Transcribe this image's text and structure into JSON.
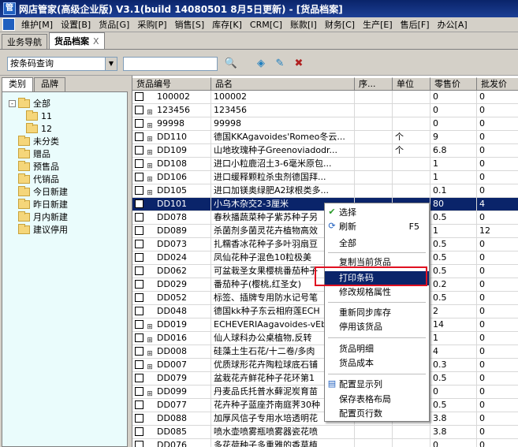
{
  "title": "网店管家(高级企业版) V3.1(build 14080501 8月5日更新) - [货品档案]",
  "menu": [
    "维护[M]",
    "设置[B]",
    "货品[G]",
    "采购[P]",
    "销售[S]",
    "库存[K]",
    "CRM[C]",
    "账款[I]",
    "财务[C]",
    "生产[E]",
    "售后[F]",
    "办公[A]"
  ],
  "doc_tabs": [
    {
      "label": "业务导航"
    },
    {
      "label": "货品档案",
      "close": "X"
    }
  ],
  "toolbar": {
    "query_mode": "按条码查询",
    "search_value": ""
  },
  "left_tabs": [
    "类别",
    "品牌"
  ],
  "tree": [
    {
      "label": "全部",
      "expander": "-"
    },
    {
      "label": "11"
    },
    {
      "label": "12"
    },
    {
      "label": "未分类"
    },
    {
      "label": "赠品"
    },
    {
      "label": "预售品"
    },
    {
      "label": "代销品"
    },
    {
      "label": "今日新建"
    },
    {
      "label": "昨日新建"
    },
    {
      "label": "月内新建"
    },
    {
      "label": "建议停用"
    }
  ],
  "grid": {
    "columns": [
      "货品编号",
      "品名",
      "序...",
      "单位",
      "零售价",
      "批发价"
    ],
    "rows": [
      {
        "code": "100002",
        "name": "100002",
        "seq": "",
        "unit": "",
        "retail": "0",
        "wholesale": "0",
        "icon": false
      },
      {
        "code": "123456",
        "name": "123456",
        "seq": "",
        "unit": "",
        "retail": "0",
        "wholesale": "0",
        "icon": true
      },
      {
        "code": "99998",
        "name": "99998",
        "seq": "",
        "unit": "",
        "retail": "0",
        "wholesale": "0",
        "icon": true
      },
      {
        "code": "DD110",
        "name": "德国KKAgavoides'Romeo冬云...",
        "seq": "",
        "unit": "个",
        "retail": "9",
        "wholesale": "0",
        "icon": true
      },
      {
        "code": "DD109",
        "name": "山地玫瑰种子Greenoviadodr...",
        "seq": "",
        "unit": "个",
        "retail": "6.8",
        "wholesale": "0",
        "icon": true
      },
      {
        "code": "DD108",
        "name": "进口小粒鹿沼土3-6毫米原包...",
        "seq": "",
        "unit": "",
        "retail": "1",
        "wholesale": "0",
        "icon": true
      },
      {
        "code": "DD106",
        "name": "进口缓释颗粒杀虫剂德国拜...",
        "seq": "",
        "unit": "",
        "retail": "1",
        "wholesale": "0",
        "icon": true
      },
      {
        "code": "DD105",
        "name": "进口加镁奥绿肥A2球根类多...",
        "seq": "",
        "unit": "",
        "retail": "0.1",
        "wholesale": "0",
        "icon": true
      },
      {
        "code": "DD101",
        "name": "小乌木杂交2-3厘米",
        "seq": "",
        "unit": "",
        "retail": "80",
        "wholesale": "4",
        "icon": false,
        "selected": true
      },
      {
        "code": "DD078",
        "name": "春秋播蔬菜种子紫苏种子另",
        "seq": "",
        "unit": "",
        "retail": "0.5",
        "wholesale": "0",
        "icon": false
      },
      {
        "code": "DD089",
        "name": "杀菌剂多菌灵花卉植物高效",
        "seq": "",
        "unit": "",
        "retail": "1",
        "wholesale": "12",
        "icon": false
      },
      {
        "code": "DD073",
        "name": "扎糯香冰花种子多叶羽扇豆",
        "seq": "",
        "unit": "",
        "retail": "0.5",
        "wholesale": "0",
        "icon": false
      },
      {
        "code": "DD024",
        "name": "凤仙花种子混色10粒极美",
        "seq": "",
        "unit": "",
        "retail": "0.5",
        "wholesale": "0",
        "icon": false
      },
      {
        "code": "DD062",
        "name": "可盆栽圣女果樱桃番茄种子",
        "seq": "",
        "unit": "",
        "retail": "0.5",
        "wholesale": "0",
        "icon": false
      },
      {
        "code": "DD029",
        "name": "番茄种子(樱桃,红圣女)",
        "seq": "",
        "unit": "",
        "retail": "0.2",
        "wholesale": "0",
        "icon": false
      },
      {
        "code": "DD052",
        "name": "标签、插牌专用防水记号笔",
        "seq": "",
        "unit": "",
        "retail": "0.5",
        "wholesale": "0",
        "icon": false
      },
      {
        "code": "DD048",
        "name": "德国kk种子东云相府莲ECH",
        "seq": "",
        "unit": "",
        "retail": "2",
        "wholesale": "0",
        "icon": false
      },
      {
        "code": "DD019",
        "name": "ECHEVERIAagavoides-vEbc",
        "seq": "",
        "unit": "",
        "retail": "14",
        "wholesale": "0",
        "icon": true
      },
      {
        "code": "DD016",
        "name": "仙人球科办公桌植物,反转",
        "seq": "",
        "unit": "",
        "retail": "1",
        "wholesale": "0",
        "icon": true
      },
      {
        "code": "DD008",
        "name": "硅藻土生石花/十二卷/多肉",
        "seq": "",
        "unit": "",
        "retail": "4",
        "wholesale": "0",
        "icon": true
      },
      {
        "code": "DD007",
        "name": "优质球形花卉陶粒球底石铺",
        "seq": "",
        "unit": "",
        "retail": "0.3",
        "wholesale": "0",
        "icon": true
      },
      {
        "code": "DD079",
        "name": "盆栽花卉鲜花种子花环第1",
        "seq": "",
        "unit": "",
        "retail": "0.5",
        "wholesale": "0",
        "icon": false
      },
      {
        "code": "DD099",
        "name": "丹麦品氏托普水藓泥炭育苗",
        "seq": "",
        "unit": "",
        "retail": "0",
        "wholesale": "0",
        "icon": true
      },
      {
        "code": "DD077",
        "name": "花卉种子蓝座芥南庭荠30种",
        "seq": "",
        "unit": "",
        "retail": "0.5",
        "wholesale": "0",
        "icon": false
      },
      {
        "code": "DD088",
        "name": "加厚风信子专用水培透明花",
        "seq": "",
        "unit": "",
        "retail": "3.8",
        "wholesale": "0",
        "icon": false
      },
      {
        "code": "DD085",
        "name": "喷水壶喷雾瓶喷雾器瓷花喷",
        "seq": "",
        "unit": "",
        "retail": "3.8",
        "wholesale": "0",
        "icon": false
      },
      {
        "code": "DD076",
        "name": "多花荷种子多重雅的香草植",
        "seq": "",
        "unit": "",
        "retail": "0",
        "wholesale": "0",
        "icon": false
      }
    ]
  },
  "context_menu": {
    "items": [
      {
        "label": "选择",
        "icon": "check-icon"
      },
      {
        "label": "刷新",
        "shortcut": "F5",
        "icon": "refresh-icon"
      },
      {
        "label": "全部"
      },
      {
        "label": "复制当前货品"
      },
      {
        "label": "打印条码",
        "highlighted": true
      },
      {
        "label": "修改规格属性"
      },
      {
        "label": "重新同步库存"
      },
      {
        "label": "停用该货品"
      },
      {
        "label": "货品明细"
      },
      {
        "label": "货品成本"
      },
      {
        "label": "配置显示列",
        "icon": "columns-icon"
      },
      {
        "label": "保存表格布局"
      },
      {
        "label": "配置页行数"
      }
    ]
  },
  "colors": {
    "selection": "#0a246a",
    "tree_bg": "#eafcfc",
    "highlight_border": "#e01020"
  }
}
